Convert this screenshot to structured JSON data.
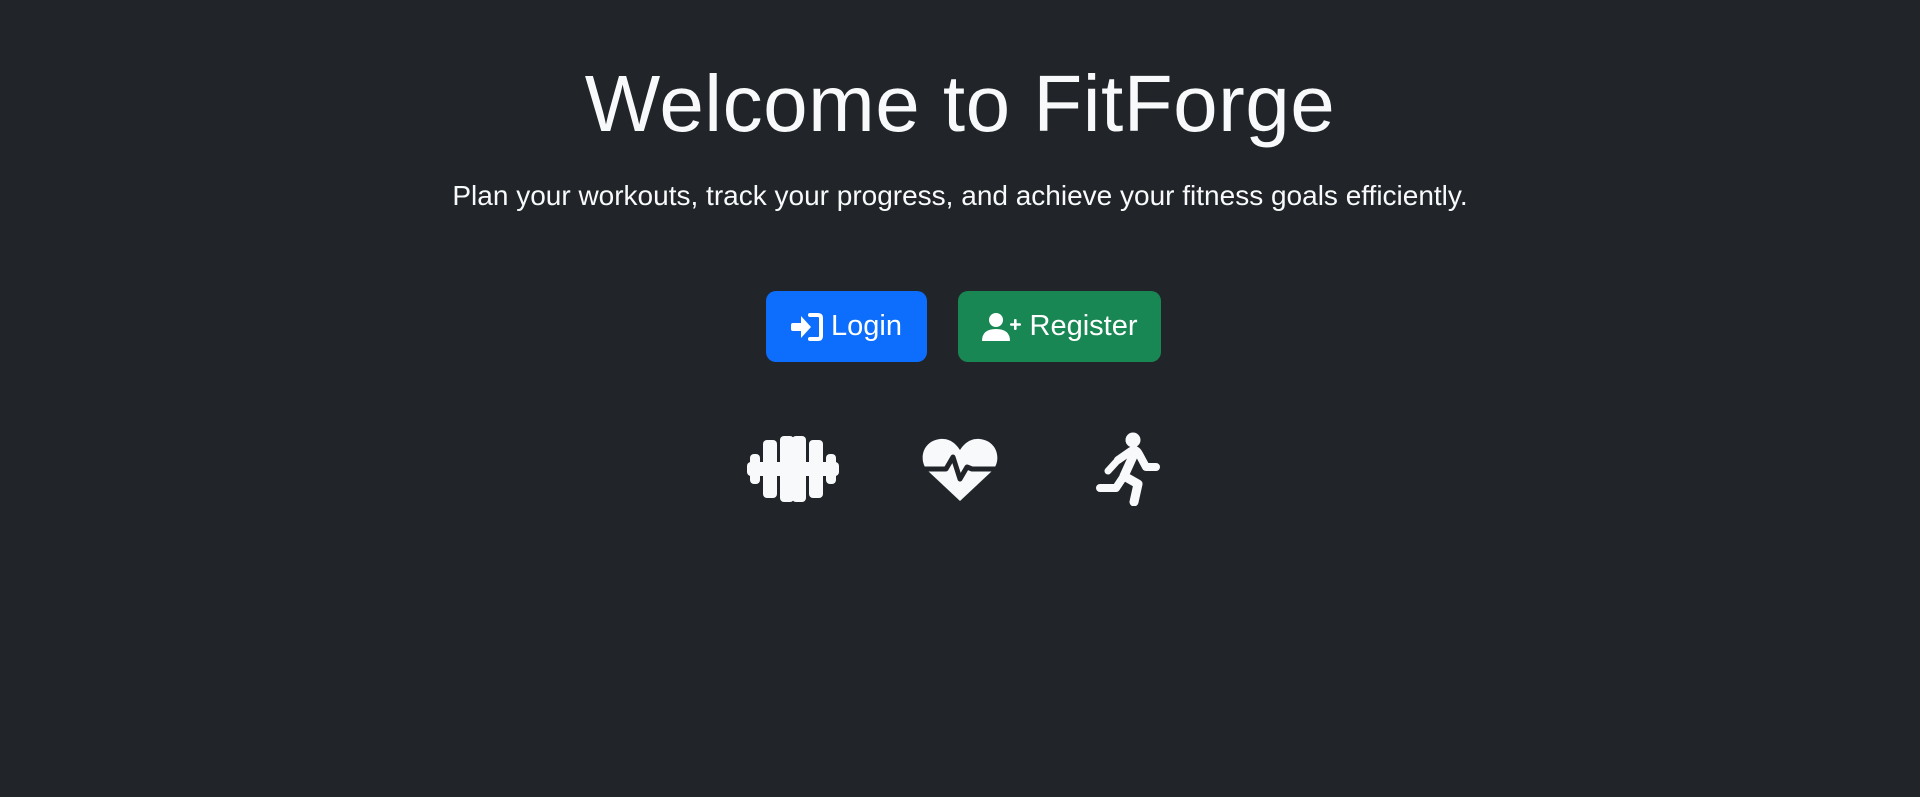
{
  "hero": {
    "title": "Welcome to FitForge",
    "subtitle": "Plan your workouts, track your progress, and achieve your fitness goals efficiently."
  },
  "actions": {
    "login_label": "Login",
    "login_icon": "sign-in-icon",
    "register_label": "Register",
    "register_icon": "user-plus-icon"
  },
  "features": [
    {
      "icon": "dumbbell-icon"
    },
    {
      "icon": "heart-pulse-icon"
    },
    {
      "icon": "running-person-icon"
    }
  ],
  "colors": {
    "background": "#212529",
    "text": "#f8f9fa",
    "login": "#0d6efd",
    "register": "#198754"
  }
}
